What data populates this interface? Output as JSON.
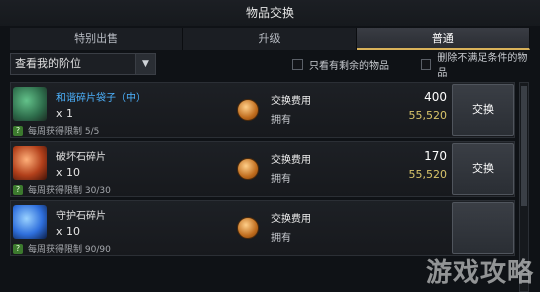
{
  "window": {
    "title": "物品交换"
  },
  "tabs": [
    {
      "label": "特别出售",
      "active": false
    },
    {
      "label": "升级",
      "active": false
    },
    {
      "label": "普通",
      "active": true
    }
  ],
  "filters": {
    "dropdown": {
      "value": "查看我的阶位",
      "icon": "chevron-down-icon"
    },
    "checkbox_remaining": {
      "label": "只看有剩余的物品",
      "checked": false
    },
    "checkbox_remove_unmet": {
      "label": "删除不满足条件的物品",
      "checked": false
    }
  },
  "items": [
    {
      "name": "和谐碎片袋子（中）",
      "name_color": "#4db3ff",
      "quantity": "x 1",
      "limit_label": "每周获得限制 5/5",
      "cost_label": "交换费用",
      "cost_value": "400",
      "own_label": "拥有",
      "own_value": "55,520",
      "button": "交换",
      "icon": "bag-icon"
    },
    {
      "name": "破坏石碎片",
      "name_color": "#e5e5e5",
      "quantity": "x 10",
      "limit_label": "每周获得限制 30/30",
      "cost_label": "交换费用",
      "cost_value": "170",
      "own_label": "拥有",
      "own_value": "55,520",
      "button": "交换",
      "icon": "destruction-stone-icon"
    },
    {
      "name": "守护石碎片",
      "name_color": "#e5e5e5",
      "quantity": "x 10",
      "limit_label": "每周获得限制 90/90",
      "cost_label": "交换费用",
      "cost_value": "",
      "own_label": "拥有",
      "own_value": "",
      "button": "",
      "icon": "guardian-stone-icon"
    }
  ],
  "watermark": {
    "text": "游戏攻略"
  }
}
